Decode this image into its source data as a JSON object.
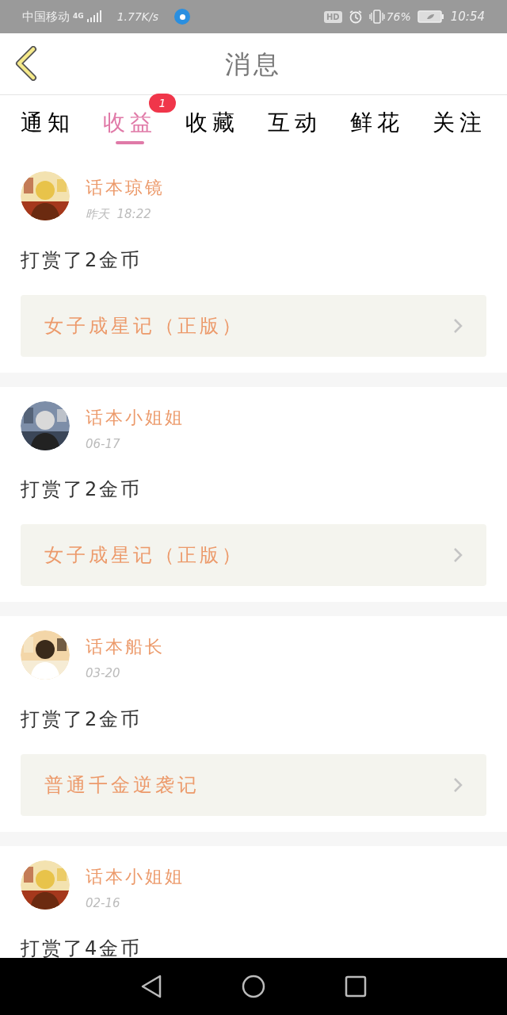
{
  "status_bar": {
    "carrier": "中国移动",
    "network": "4G",
    "speed": "1.77K/s",
    "hd": "HD",
    "battery_text": "76%",
    "time": "10:54"
  },
  "header": {
    "title": "消息"
  },
  "tabs": [
    {
      "label": "通知",
      "selected": false
    },
    {
      "label": "收益",
      "selected": true,
      "badge": "1"
    },
    {
      "label": "收藏",
      "selected": false
    },
    {
      "label": "互动",
      "selected": false
    },
    {
      "label": "鲜花",
      "selected": false
    },
    {
      "label": "关注",
      "selected": false
    }
  ],
  "messages": [
    {
      "user": "话本琼镜",
      "time": "昨天  18:22",
      "text": "打赏了2金币",
      "book": "女子成星记（正版）"
    },
    {
      "user": "话本小姐姐",
      "time": "06-17",
      "text": "打赏了2金币",
      "book": "女子成星记（正版）"
    },
    {
      "user": "话本船长",
      "time": "03-20",
      "text": "打赏了2金币",
      "book": "普通千金逆袭记"
    },
    {
      "user": "话本小姐姐",
      "time": "02-16",
      "text": "打赏了4金币"
    }
  ]
}
